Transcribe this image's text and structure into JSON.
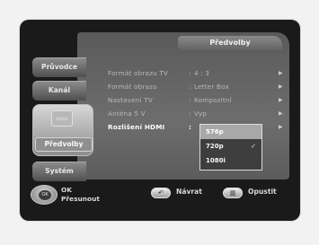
{
  "header": {
    "title": "Předvolby"
  },
  "tabs": [
    {
      "label": "Průvodce"
    },
    {
      "label": "Kanál"
    },
    {
      "label": "Předvolby",
      "icon": "settings-tv-icon"
    },
    {
      "label": "Systém"
    }
  ],
  "settings": [
    {
      "label": "Formát obrazu TV",
      "separator": ":",
      "value": "4 : 3"
    },
    {
      "label": "Formát obrazu",
      "separator": ":",
      "value": "Letter Box"
    },
    {
      "label": "Nastavení TV",
      "separator": ":",
      "value": "Kompozitní"
    },
    {
      "label": "Anténa 5 V",
      "separator": ":",
      "value": "Vyp"
    },
    {
      "label": "Rozlišení HDMI",
      "separator": ":",
      "value": ""
    }
  ],
  "hdmi_dropdown": {
    "options": [
      "576p",
      "720p",
      "1080i"
    ],
    "highlighted": "576p",
    "checked": "720p"
  },
  "footer": {
    "ok_label": "OK",
    "move_label": "Přesunout",
    "back_label": "Návrat",
    "exit_label": "Opustit"
  }
}
